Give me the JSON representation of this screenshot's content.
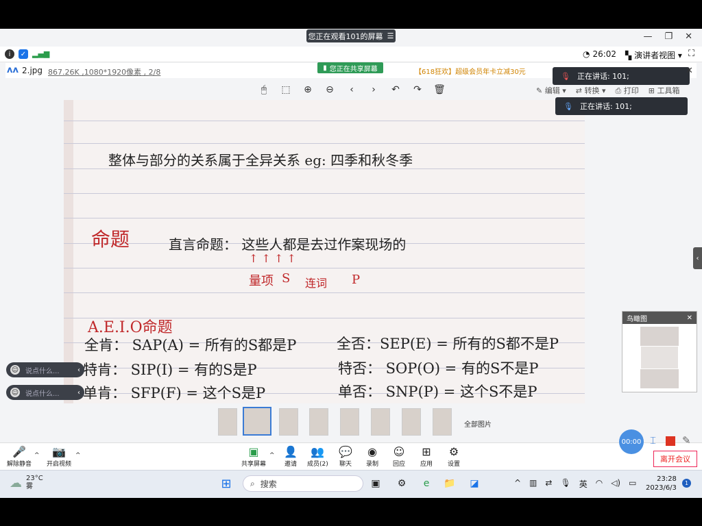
{
  "banner": {
    "viewing": "您正在观看101的屏幕",
    "menu_icon": "☰"
  },
  "window_controls": {
    "minimize": "—",
    "restore": "❐",
    "close": "✕"
  },
  "info_bar": {
    "timer": "26:02",
    "presenter_view": "演讲者视图"
  },
  "viewer": {
    "file_name": "2.jpg",
    "file_meta": "867.26K ,1080*1920像素 , 2/8",
    "sharing": "您正在共享屏幕",
    "promo": "【618狂欢】超级会员年卡立减30元",
    "right_tools": {
      "edit": "编辑",
      "convert": "转换",
      "print": "打印",
      "toolbox": "工具箱"
    }
  },
  "note": {
    "line1": "整体与部分的关系属于全异关系    eg: 四季和秋冬季",
    "title": "命题",
    "line2": "直言命题： 这些人都是去过作案现场的",
    "arrows": "↑       ↑         ↑              ↑",
    "line3a": "量项",
    "line3b": "S",
    "line3c": "连词",
    "line3d": "P",
    "aeio": "A.E.I.O命题",
    "r1a": "全肯：  SAP(A) = 所有的S都是P",
    "r1b": "全否：SEP(E) = 所有的S都不是P",
    "r2a": "特肯：  SIP(I) =  有的S是P",
    "r2b": "特否：  SOP(O) = 有的S不是P",
    "r3a": "单肯：  SFP(F) = 这个S是P",
    "r3b": "单否：  SNP(P) = 这个S不是P"
  },
  "speakers": [
    {
      "label": "正在讲话:  101;"
    },
    {
      "label": "正在讲话:  101;"
    }
  ],
  "birdview": {
    "title": "鸟瞰图"
  },
  "chat": [
    {
      "placeholder": "说点什么..."
    },
    {
      "placeholder": "说点什么..."
    }
  ],
  "all_images": "全部图片",
  "meeting_toolbar": {
    "unmute": "解除静音",
    "start_video": "开启视频",
    "share": "共享屏幕",
    "invite": "邀请",
    "members": "成员(2)",
    "chat": "聊天",
    "record": "录制",
    "reactions": "回应",
    "apps": "应用",
    "settings": "设置",
    "leave": "离开会议",
    "rec_time": "00:00"
  },
  "taskbar": {
    "temp": "23°C",
    "weather": "雾",
    "search": "搜索",
    "ime": "英",
    "time": "23:28",
    "date": "2023/6/3",
    "notifications": "1"
  }
}
